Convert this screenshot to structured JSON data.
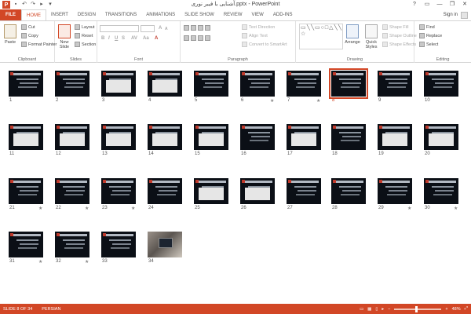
{
  "window": {
    "title": "آشنایی با فیبر نوری.pptx - PowerPoint",
    "controls": [
      "?",
      "▭",
      "—",
      "❐",
      "✕"
    ]
  },
  "tabs": [
    "FILE",
    "HOME",
    "INSERT",
    "DESIGN",
    "TRANSITIONS",
    "ANIMATIONS",
    "SLIDE SHOW",
    "REVIEW",
    "VIEW",
    "ADD-INS"
  ],
  "active_tab": "HOME",
  "signin": "Sign in",
  "ribbon": {
    "clipboard": {
      "paste": "Paste",
      "cut": "Cut",
      "copy": "Copy",
      "format_painter": "Format Painter",
      "label": "Clipboard"
    },
    "slides": {
      "new_slide": "New Slide",
      "layout": "Layout",
      "reset": "Reset",
      "section": "Section",
      "label": "Slides"
    },
    "font": {
      "label": "Font",
      "grow": "A",
      "shrink": "A",
      "bold": "B",
      "italic": "I",
      "underline": "U",
      "strike": "S",
      "spacing": "AV",
      "case": "Aa",
      "color": "A"
    },
    "paragraph": {
      "text_direction": "Text Direction",
      "align_text": "Align Text",
      "smartart": "Convert to SmartArt",
      "label": "Paragraph"
    },
    "drawing": {
      "arrange": "Arrange",
      "quick_styles": "Quick Styles",
      "shape_fill": "Shape Fill",
      "shape_outline": "Shape Outline",
      "shape_effects": "Shape Effects",
      "label": "Drawing",
      "gallery": "▭╲╲▭○□△╲╲⌐⌐◇⬠▷{}☆"
    },
    "editing": {
      "find": "Find",
      "replace": "Replace",
      "select": "Select",
      "label": "Editing"
    }
  },
  "slides": [
    {
      "n": "1",
      "star": false
    },
    {
      "n": "2",
      "star": false
    },
    {
      "n": "3",
      "star": false
    },
    {
      "n": "4",
      "star": false
    },
    {
      "n": "5",
      "star": false
    },
    {
      "n": "6",
      "star": true
    },
    {
      "n": "7",
      "star": true
    },
    {
      "n": "8",
      "star": false
    },
    {
      "n": "9",
      "star": false
    },
    {
      "n": "10",
      "star": false
    },
    {
      "n": "11",
      "star": false
    },
    {
      "n": "12",
      "star": false
    },
    {
      "n": "13",
      "star": false
    },
    {
      "n": "14",
      "star": false
    },
    {
      "n": "15",
      "star": false
    },
    {
      "n": "16",
      "star": false
    },
    {
      "n": "17",
      "star": false
    },
    {
      "n": "18",
      "star": false
    },
    {
      "n": "19",
      "star": false
    },
    {
      "n": "20",
      "star": false
    },
    {
      "n": "21",
      "star": true
    },
    {
      "n": "22",
      "star": true
    },
    {
      "n": "23",
      "star": true
    },
    {
      "n": "24",
      "star": false
    },
    {
      "n": "25",
      "star": false
    },
    {
      "n": "26",
      "star": false
    },
    {
      "n": "27",
      "star": false
    },
    {
      "n": "28",
      "star": false
    },
    {
      "n": "29",
      "star": true
    },
    {
      "n": "30",
      "star": true
    },
    {
      "n": "31",
      "star": true
    },
    {
      "n": "32",
      "star": true
    },
    {
      "n": "33",
      "star": false
    },
    {
      "n": "34",
      "star": false
    }
  ],
  "selected_slide": "8",
  "star_glyph": "★",
  "status": {
    "slide_info": "SLIDE 8 OF 34",
    "language": "PERSIAN",
    "zoom": "48%",
    "zoom_fraction": 0.48
  },
  "colors": {
    "accent": "#d24726"
  }
}
